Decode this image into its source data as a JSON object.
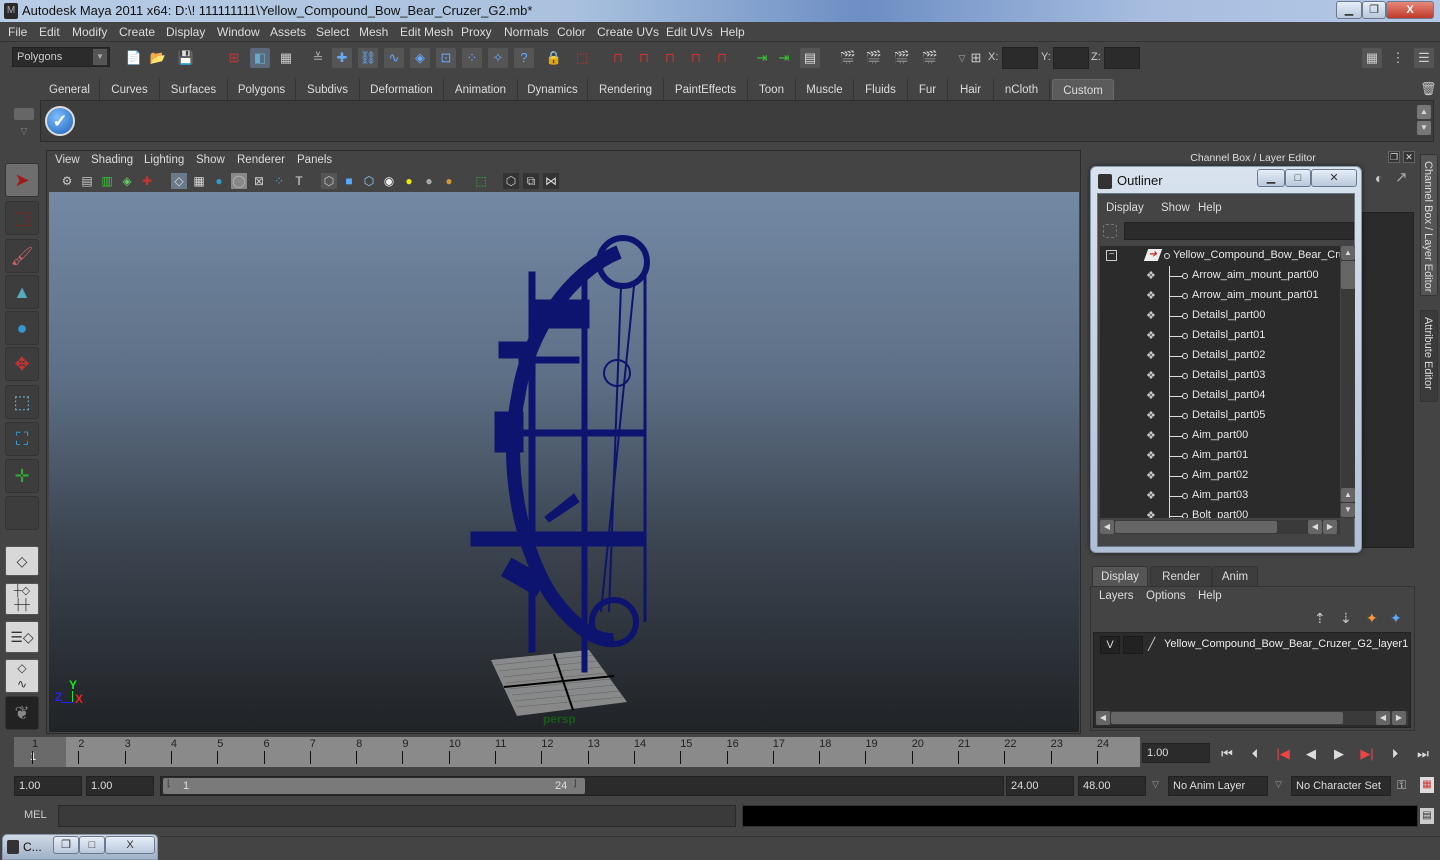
{
  "window": {
    "title": "Autodesk Maya 2011 x64: D:\\! 111111111\\Yellow_Compound_Bow_Bear_Cruzer_G2.mb*",
    "minimize_icon": "minimize-icon",
    "restore_icon": "restore-icon",
    "close_icon": "close-icon"
  },
  "menubar": [
    "File",
    "Edit",
    "Modify",
    "Create",
    "Display",
    "Window",
    "Assets",
    "Select",
    "Mesh",
    "Edit Mesh",
    "Proxy",
    "Normals",
    "Color",
    "Create UVs",
    "Edit UVs",
    "Help"
  ],
  "statusline": {
    "mode": "Polygons",
    "x_label": "X:",
    "y_label": "Y:",
    "z_label": "Z:",
    "x_value": "",
    "y_value": "",
    "z_value": ""
  },
  "shelf": {
    "tabs": [
      "General",
      "Curves",
      "Surfaces",
      "Polygons",
      "Subdivs",
      "Deformation",
      "Animation",
      "Dynamics",
      "Rendering",
      "PaintEffects",
      "Toon",
      "Muscle",
      "Fluids",
      "Fur",
      "Hair",
      "nCloth",
      "Custom"
    ],
    "active_tab": "Custom",
    "items": [
      "checkmark-icon"
    ]
  },
  "toolbox": {
    "tools": [
      "select-tool",
      "lasso-tool",
      "paint-select-tool",
      "move-tool",
      "rotate-tool",
      "scale-tool",
      "universal-manipulator",
      "soft-modification-tool",
      "show-manipulator-tool",
      "last-tool"
    ],
    "active": "select-tool"
  },
  "viewport": {
    "menu": [
      "View",
      "Shading",
      "Lighting",
      "Show",
      "Renderer",
      "Panels"
    ],
    "camera": "persp",
    "axis": {
      "x": "X",
      "y": "Y",
      "z": "Z"
    },
    "colors": {
      "wireframe": "#0d1470",
      "bg_top": "#7389a4",
      "bg_bottom": "#202326"
    }
  },
  "channel_box": {
    "title": "Channel Box / Layer Editor"
  },
  "side_tabs": [
    "Channel Box / Layer Editor",
    "Attribute Editor"
  ],
  "outliner": {
    "title": "Outliner",
    "menu": [
      "Display",
      "Show",
      "Help"
    ],
    "search": "",
    "root": "Yellow_Compound_Bow_Bear_Cruz",
    "items": [
      "Arrow_aim_mount_part00",
      "Arrow_aim_mount_part01",
      "Detailsl_part00",
      "Detailsl_part01",
      "Detailsl_part02",
      "Detailsl_part03",
      "Detailsl_part04",
      "Detailsl_part05",
      "Aim_part00",
      "Aim_part01",
      "Aim_part02",
      "Aim_part03",
      "Bolt_part00"
    ]
  },
  "layer_editor": {
    "tabs": [
      "Display",
      "Render",
      "Anim"
    ],
    "active_tab": "Display",
    "menu": [
      "Layers",
      "Options",
      "Help"
    ],
    "layers": [
      {
        "visible": "V",
        "name": "Yellow_Compound_Bow_Bear_Cruzer_G2_layer1"
      }
    ]
  },
  "timeline": {
    "ticks": [
      "1",
      "2",
      "3",
      "4",
      "5",
      "6",
      "7",
      "8",
      "9",
      "10",
      "11",
      "12",
      "13",
      "14",
      "15",
      "16",
      "17",
      "18",
      "19",
      "20",
      "21",
      "22",
      "23",
      "24"
    ],
    "current_frame_label": "1",
    "current_frame": "1.00"
  },
  "range": {
    "start": "1.00",
    "playback_start": "1.00",
    "range_start_label": "1",
    "range_end_label": "24",
    "playback_end": "24.00",
    "end": "48.00",
    "anim_layer": "No Anim Layer",
    "character_set": "No Character Set"
  },
  "command_line": {
    "label": "MEL",
    "input": "",
    "result": ""
  },
  "minimized_window": {
    "title": "C..."
  }
}
